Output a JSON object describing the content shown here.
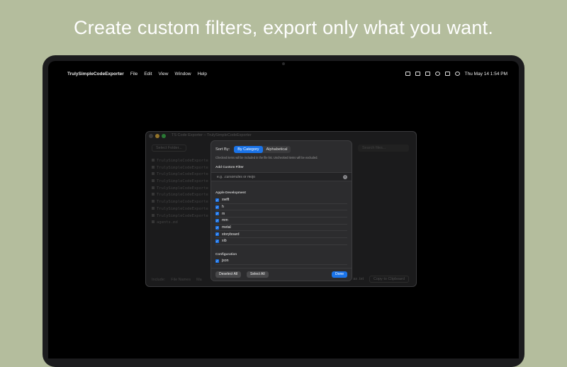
{
  "headline": "Create custom filters, export only what you want.",
  "menubar": {
    "app_name": "TrulySimpleCodeExporter",
    "menus": [
      "File",
      "Edit",
      "View",
      "Window",
      "Help"
    ],
    "clock": "Thu May 14  1:54 PM"
  },
  "window": {
    "title": "TS Code Exporter – TrulySimpleCodeExporter",
    "select_folder": "Select Folder...",
    "search_placeholder": "Search files...",
    "files": [
      "TrulySimpleCodeExporte",
      "TrulySimpleCodeExporte",
      "TrulySimpleCodeExporte",
      "TrulySimpleCodeExporte",
      "TrulySimpleCodeExporte",
      "TrulySimpleCodeExporte",
      "TrulySimpleCodeExporte",
      "TrulySimpleCodeExporte",
      "TrulySimpleCodeExporte",
      "agents.md"
    ],
    "footer_include": "Include:",
    "footer_file_names": "File Names",
    "footer_ma": "Ma",
    "footer_txt": "as .txt",
    "copy_button": "Copy to Clipboard"
  },
  "sheet": {
    "sort_by_label": "Sort By:",
    "sort_options": [
      "By Category",
      "Alphabetical"
    ],
    "sort_selected": "By Category",
    "note": "Checked items will be included in the file list. Unchecked items will be excluded.",
    "add_custom_filter_label": "Add Custom Filter",
    "custom_filter_placeholder": "e.g. .cursorrules or mojo",
    "apple_dev_label": "Apple Development",
    "apple_dev_items": [
      {
        "label": "swift",
        "checked": true
      },
      {
        "label": "h",
        "checked": true
      },
      {
        "label": "m",
        "checked": true
      },
      {
        "label": "mm",
        "checked": true
      },
      {
        "label": "metal",
        "checked": true
      },
      {
        "label": "storyboard",
        "checked": true
      },
      {
        "label": "xib",
        "checked": true
      }
    ],
    "config_label": "Configuration",
    "config_items": [
      {
        "label": "json",
        "checked": true
      }
    ],
    "deselect_all": "Deselect All",
    "select_all": "Select All",
    "done": "Done"
  },
  "colors": {
    "background": "#b4bd9d",
    "accent": "#1a73e8"
  }
}
